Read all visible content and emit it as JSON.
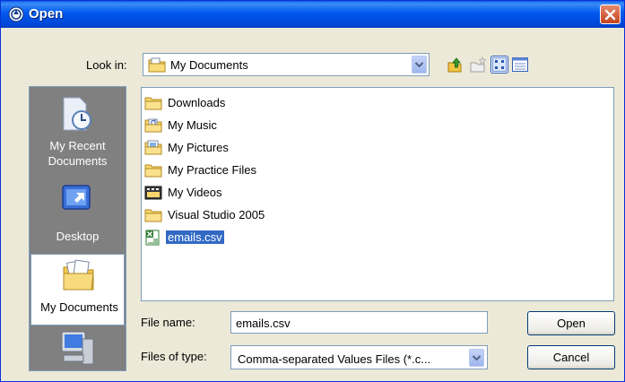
{
  "window": {
    "title": "Open",
    "title_icon": "open-dialog-icon",
    "close_icon": "close-icon"
  },
  "lookin": {
    "label": "Look in:",
    "value": "My Documents",
    "icon": "my-documents-folder-icon"
  },
  "toolbar": {
    "items": [
      "up-one-level-icon",
      "create-new-folder-icon",
      "view-menu-icon",
      "details-view-icon"
    ]
  },
  "places": [
    {
      "label": "My Recent Documents",
      "icon": "recent-documents-icon",
      "active": false
    },
    {
      "label": "Desktop",
      "icon": "desktop-icon",
      "active": false
    },
    {
      "label": "My Documents",
      "icon": "my-documents-icon",
      "active": true
    },
    {
      "label": "",
      "icon": "my-computer-icon",
      "active": false
    }
  ],
  "files": [
    {
      "name": "Downloads",
      "icon": "folder-icon",
      "selected": false
    },
    {
      "name": "My Music",
      "icon": "music-folder-icon",
      "selected": false
    },
    {
      "name": "My Pictures",
      "icon": "pictures-folder-icon",
      "selected": false
    },
    {
      "name": "My Practice Files",
      "icon": "folder-icon",
      "selected": false
    },
    {
      "name": "My Videos",
      "icon": "videos-folder-icon",
      "selected": false
    },
    {
      "name": "Visual Studio 2005",
      "icon": "folder-icon",
      "selected": false
    },
    {
      "name": "emails.csv",
      "icon": "excel-csv-file-icon",
      "selected": true
    }
  ],
  "filename": {
    "label": "File name:",
    "value": "emails.csv"
  },
  "filetype": {
    "label": "Files of type:",
    "value": "Comma-separated Values Files (*.c..."
  },
  "buttons": {
    "open": "Open",
    "cancel": "Cancel"
  },
  "colors": {
    "title_bar": "#0058ee",
    "selection": "#316ac5",
    "places_bar": "#808080",
    "dialog_face": "#ece9d8"
  }
}
